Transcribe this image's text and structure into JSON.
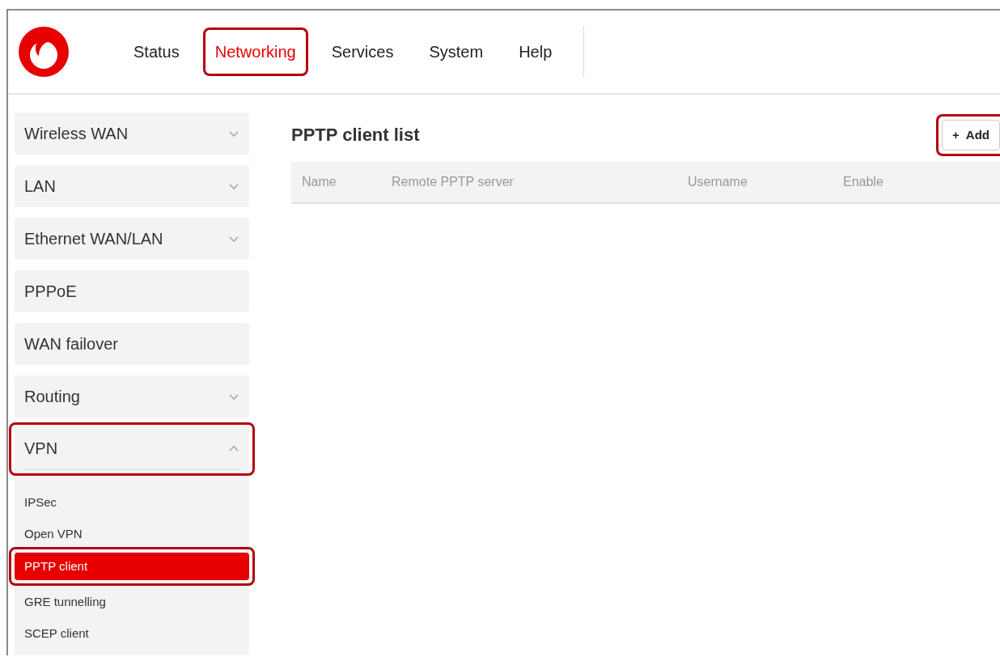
{
  "nav": [
    {
      "label": "Status",
      "selected": false,
      "highlighted": false
    },
    {
      "label": "Networking",
      "selected": true,
      "highlighted": true
    },
    {
      "label": "Services",
      "selected": false,
      "highlighted": false
    },
    {
      "label": "System",
      "selected": false,
      "highlighted": false
    },
    {
      "label": "Help",
      "selected": false,
      "highlighted": false
    }
  ],
  "sidebar": {
    "items": [
      {
        "label": "Wireless WAN",
        "kind": "group",
        "expanded": false,
        "highlighted": false
      },
      {
        "label": "LAN",
        "kind": "group",
        "expanded": false,
        "highlighted": false
      },
      {
        "label": "Ethernet WAN/LAN",
        "kind": "group",
        "expanded": false,
        "highlighted": false
      },
      {
        "label": "PPPoE",
        "kind": "link",
        "highlighted": false
      },
      {
        "label": "WAN failover",
        "kind": "link",
        "highlighted": false
      },
      {
        "label": "Routing",
        "kind": "group",
        "expanded": false,
        "highlighted": false
      },
      {
        "label": "VPN",
        "kind": "group",
        "expanded": true,
        "highlighted": true,
        "children": [
          {
            "label": "IPSec",
            "selected": false,
            "highlighted": false
          },
          {
            "label": "Open VPN",
            "selected": false,
            "highlighted": false
          },
          {
            "label": "PPTP client",
            "selected": true,
            "highlighted": true
          },
          {
            "label": "GRE tunnelling",
            "selected": false,
            "highlighted": false
          },
          {
            "label": "SCEP client",
            "selected": false,
            "highlighted": false
          }
        ]
      }
    ]
  },
  "content": {
    "title": "PPTP client list",
    "add_button": {
      "icon": "+",
      "label": "Add",
      "highlighted": true
    },
    "table": {
      "columns": [
        "Name",
        "Remote PPTP server",
        "Username",
        "Enable"
      ]
    }
  }
}
